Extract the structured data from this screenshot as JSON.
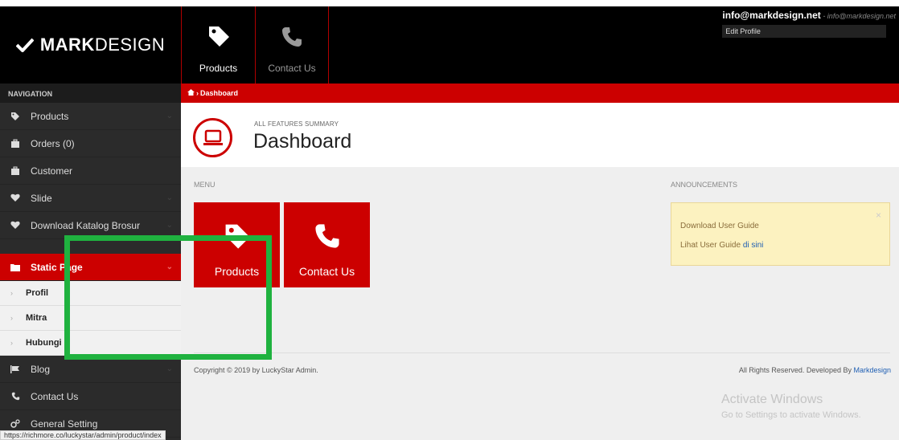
{
  "brand": {
    "strong": "MARK",
    "light": "DESIGN"
  },
  "topnav": [
    {
      "label": "Products",
      "icon": "tag-icon"
    },
    {
      "label": "Contact Us",
      "icon": "phone-icon"
    }
  ],
  "user": {
    "email": "info@markdesign.net",
    "sub": " - info@markdesign.net",
    "edit_profile": "Edit Profile"
  },
  "sidebar": {
    "title": "NAVIGATION",
    "items": [
      {
        "label": "Products",
        "icon": "tag-icon"
      },
      {
        "label": "Orders (0)",
        "icon": "briefcase-icon"
      },
      {
        "label": "Customer",
        "icon": "briefcase-icon"
      },
      {
        "label": "Slide",
        "icon": "heart-icon"
      },
      {
        "label": "Download Katalog Brosur",
        "icon": "heart-icon"
      }
    ],
    "active": {
      "label": "Static Page",
      "icon": "folder-icon"
    },
    "sub_items": [
      "Profil",
      "Mitra",
      "Hubungi"
    ],
    "more_items": [
      {
        "label": "Blog",
        "icon": "flag-icon"
      },
      {
        "label": "Contact Us",
        "icon": "phone-icon"
      },
      {
        "label": "General Setting",
        "icon": "cogs-icon"
      }
    ]
  },
  "breadcrumb": {
    "home_icon": "home-icon",
    "label": "Dashboard"
  },
  "page": {
    "small_title": "ALL FEATURES SUMMARY",
    "title": "Dashboard",
    "icon": "laptop-icon"
  },
  "menu": {
    "label": "MENU",
    "tiles": [
      {
        "label": "Products",
        "icon": "tag-icon"
      },
      {
        "label": "Contact Us",
        "icon": "phone-icon"
      }
    ]
  },
  "announcements": {
    "label": "ANNOUNCEMENTS",
    "line1": "Download User Guide",
    "line2_prefix": "Lihat User Guide ",
    "line2_link": "di sini",
    "close": "×"
  },
  "footer": {
    "copyright": "Copyright © 2019 by LuckyStar Admin.",
    "rights_prefix": "All Rights Reserved. Developed By ",
    "rights_link": "Markdesign"
  },
  "watermark": {
    "line1": "Activate Windows",
    "line2": "Go to Settings to activate Windows."
  },
  "status_url": "https://richmore.co/luckystar/admin/product/index",
  "colors": {
    "accent": "#cc0000",
    "highlight": "#1fb23f",
    "sidebar": "#2b2b2b"
  }
}
